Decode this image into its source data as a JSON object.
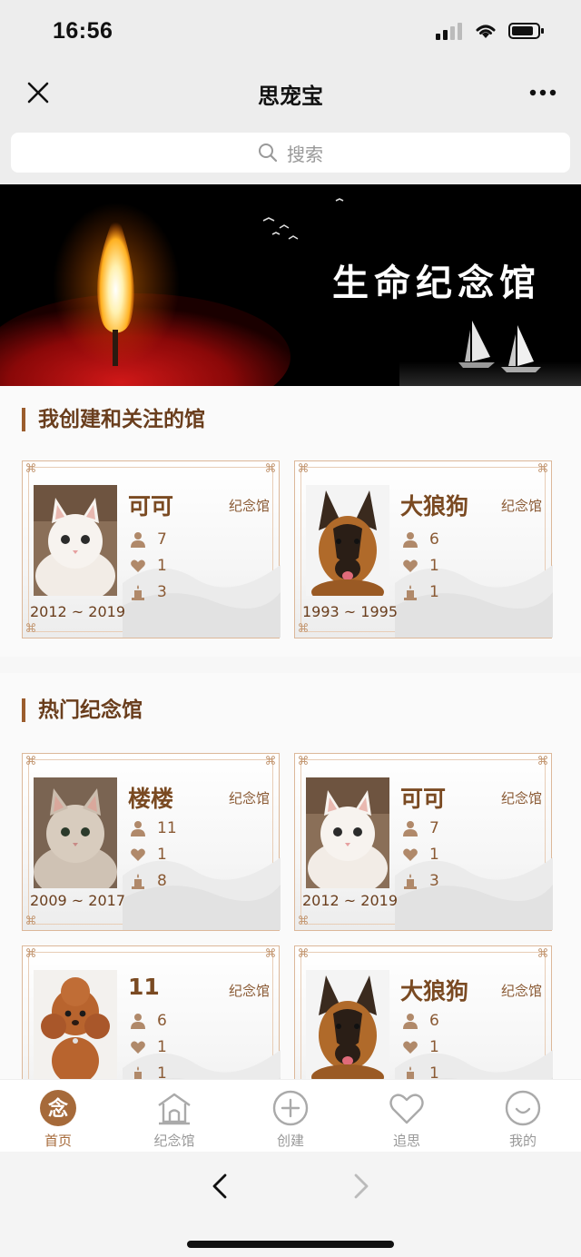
{
  "status": {
    "time": "16:56"
  },
  "nav": {
    "title": "思宠宝"
  },
  "search": {
    "placeholder": "搜索"
  },
  "banner": {
    "title": "生命纪念馆"
  },
  "my_section": {
    "title": "我创建和关注的馆",
    "cards": [
      {
        "name": "可可",
        "tag": "纪念馆",
        "visitors": "7",
        "likes": "1",
        "candles": "3",
        "years": "2012 ~ 2019",
        "photo": "white-cat"
      },
      {
        "name": "大狼狗",
        "tag": "纪念馆",
        "visitors": "6",
        "likes": "1",
        "candles": "1",
        "years": "1993 ~ 1995",
        "photo": "shepherd-dog"
      }
    ]
  },
  "hot_section": {
    "title": "热门纪念馆",
    "cards": [
      {
        "name": "楼楼",
        "tag": "纪念馆",
        "visitors": "11",
        "likes": "1",
        "candles": "8",
        "years": "2009 ~ 2017",
        "photo": "fluffy-cat"
      },
      {
        "name": "可可",
        "tag": "纪念馆",
        "visitors": "7",
        "likes": "1",
        "candles": "3",
        "years": "2012 ~ 2019",
        "photo": "white-cat"
      },
      {
        "name": "11",
        "tag": "纪念馆",
        "visitors": "6",
        "likes": "1",
        "candles": "1",
        "years": "",
        "photo": "poodle-dog"
      },
      {
        "name": "大狼狗",
        "tag": "纪念馆",
        "visitors": "6",
        "likes": "1",
        "candles": "1",
        "years": "",
        "photo": "shepherd-dog"
      }
    ]
  },
  "tabs": [
    {
      "label": "首页",
      "icon": "nian-icon",
      "active": true
    },
    {
      "label": "纪念馆",
      "icon": "hall-icon",
      "active": false
    },
    {
      "label": "创建",
      "icon": "plus-circle-icon",
      "active": false
    },
    {
      "label": "追思",
      "icon": "heart-icon",
      "active": false
    },
    {
      "label": "我的",
      "icon": "smile-icon",
      "active": false
    }
  ],
  "tab_icon_glyph": "念",
  "colors": {
    "accent": "#a66a3a",
    "title_brown": "#6a3e1d",
    "card_border": "#dcb89a"
  }
}
